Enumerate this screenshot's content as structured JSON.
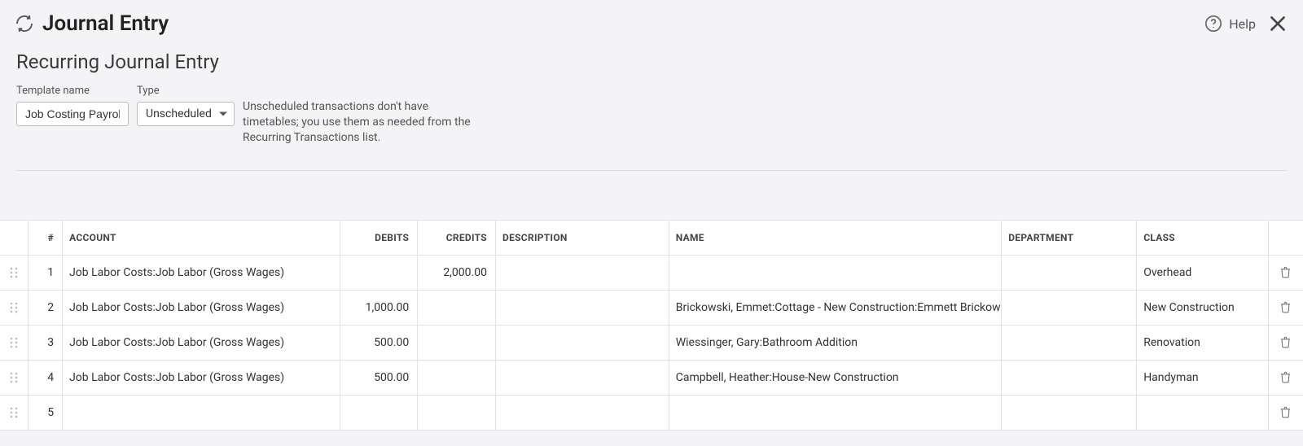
{
  "header": {
    "title": "Journal Entry",
    "help_label": "Help"
  },
  "form": {
    "subtitle": "Recurring Journal Entry",
    "template_label": "Template name",
    "template_value": "Job Costing Payroll",
    "type_label": "Type",
    "type_value": "Unscheduled",
    "hint": "Unscheduled transactions don't have timetables; you use them as needed from the Recurring Transactions list."
  },
  "table": {
    "columns": {
      "num": "#",
      "account": "ACCOUNT",
      "debits": "DEBITS",
      "credits": "CREDITS",
      "description": "DESCRIPTION",
      "name": "NAME",
      "department": "DEPARTMENT",
      "class": "CLASS"
    },
    "rows": [
      {
        "n": "1",
        "account": "Job Labor Costs:Job Labor (Gross Wages)",
        "debits": "",
        "credits": "2,000.00",
        "desc": "",
        "name": "",
        "dept": "",
        "cls": "Overhead"
      },
      {
        "n": "2",
        "account": "Job Labor Costs:Job Labor (Gross Wages)",
        "debits": "1,000.00",
        "credits": "",
        "desc": "",
        "name": "Brickowski, Emmet:Cottage - New Construction:Emmett Brickowski",
        "dept": "",
        "cls": "New Construction"
      },
      {
        "n": "3",
        "account": "Job Labor Costs:Job Labor (Gross Wages)",
        "debits": "500.00",
        "credits": "",
        "desc": "",
        "name": "Wiessinger, Gary:Bathroom Addition",
        "dept": "",
        "cls": "Renovation"
      },
      {
        "n": "4",
        "account": "Job Labor Costs:Job Labor (Gross Wages)",
        "debits": "500.00",
        "credits": "",
        "desc": "",
        "name": "Campbell, Heather:House-New Construction",
        "dept": "",
        "cls": "Handyman"
      },
      {
        "n": "5",
        "account": "",
        "debits": "",
        "credits": "",
        "desc": "",
        "name": "",
        "dept": "",
        "cls": ""
      }
    ]
  }
}
